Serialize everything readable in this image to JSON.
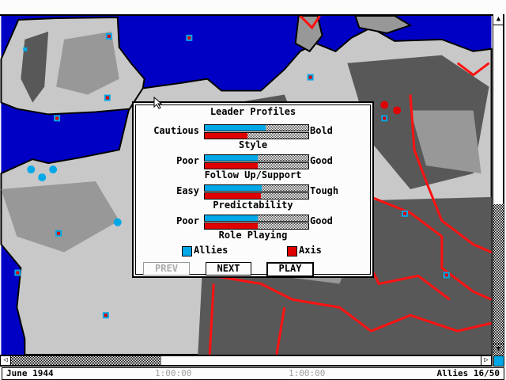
{
  "colors": {
    "allies": "#00a8e8",
    "axis": "#e00000",
    "sea": "#0000c4",
    "land_light": "#c8c8c8",
    "land_mid": "#989898",
    "land_dark": "#585858",
    "border": "#ff1010"
  },
  "dialog": {
    "title": "Leader Profiles",
    "profiles": [
      {
        "caption": "Style",
        "low": "Cautious",
        "high": "Bold",
        "allies": 0.59,
        "axis": 0.41
      },
      {
        "caption": "Follow Up/Support",
        "low": "Poor",
        "high": "Good",
        "allies": 0.51,
        "axis": 0.51
      },
      {
        "caption": "Predictability",
        "low": "Easy",
        "high": "Tough",
        "allies": 0.55,
        "axis": 0.54
      },
      {
        "caption": "Role Playing",
        "low": "Poor",
        "high": "Good",
        "allies": 0.51,
        "axis": 0.51
      }
    ],
    "legend": {
      "allies": "Allies",
      "axis": "Axis"
    },
    "buttons": {
      "prev": "PREV",
      "next": "NEXT",
      "play": "PLAY"
    }
  },
  "status": {
    "date": "June 1944",
    "timer1": "1:00:00",
    "timer2": "1:00:00",
    "score": "Allies 16/50"
  },
  "icons": {
    "up": "▲",
    "down": "▼",
    "left": "◁",
    "right": "▷"
  }
}
